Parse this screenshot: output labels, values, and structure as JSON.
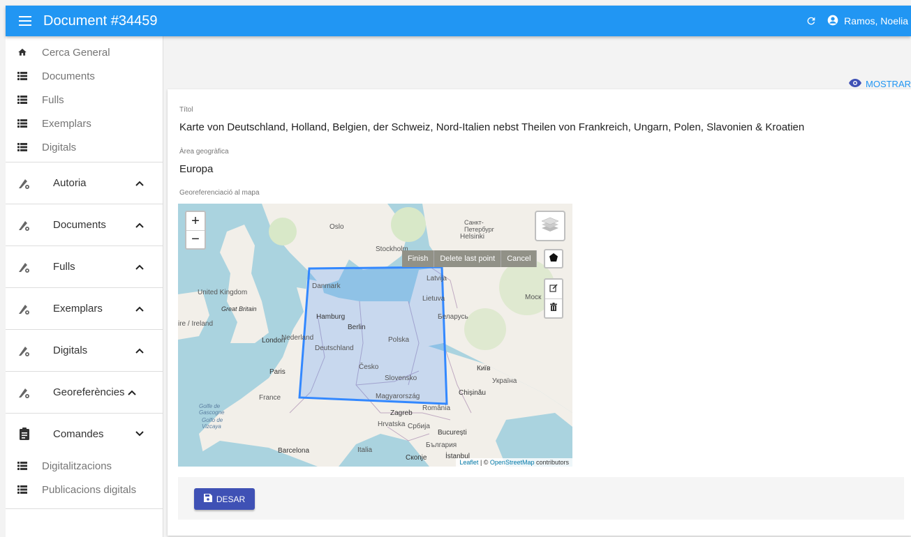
{
  "header": {
    "title": "Document #34459",
    "user_name": "Ramos, Noelia"
  },
  "sidebar": {
    "top_items": [
      {
        "label": "Cerca General",
        "icon": "home-icon"
      },
      {
        "label": "Documents",
        "icon": "list-icon"
      },
      {
        "label": "Fulls",
        "icon": "list-icon"
      },
      {
        "label": "Exemplars",
        "icon": "list-icon"
      },
      {
        "label": "Digitals",
        "icon": "list-icon"
      }
    ],
    "groups": [
      {
        "label": "Autoria",
        "chevron": "up"
      },
      {
        "label": "Documents",
        "chevron": "up"
      },
      {
        "label": "Fulls",
        "chevron": "up"
      },
      {
        "label": "Exemplars",
        "chevron": "up"
      },
      {
        "label": "Digitals",
        "chevron": "up"
      },
      {
        "label": "Georeferències",
        "chevron": "up"
      },
      {
        "label": "Comandes",
        "chevron": "down"
      }
    ],
    "bottom_items": [
      {
        "label": "Digitalitzacions",
        "icon": "list-icon"
      },
      {
        "label": "Publicacions digitals",
        "icon": "list-icon"
      }
    ]
  },
  "main": {
    "show_button": "MOSTRAR",
    "fields": {
      "title_label": "Títol",
      "title_value": "Karte von Deutschland, Holland, Belgien, der Schweiz, Nord-Italien nebst Theilen von Frankreich, Ungarn, Polen, Slavonien & Kroatien",
      "area_label": "Àrea geogràfica",
      "area_value": "Europa",
      "map_label": "Georeferenciació al mapa"
    },
    "map": {
      "zoom_in": "+",
      "zoom_out": "−",
      "draw_actions": [
        "Finish",
        "Delete last point",
        "Cancel"
      ],
      "attribution_leaflet": "Leaflet",
      "attribution_sep": " | © ",
      "attribution_osm": "OpenStreetMap",
      "attribution_tail": " contributors",
      "labels": {
        "oslo": "Oslo",
        "stockholm": "Stockholm",
        "helsinki": "Helsinki",
        "spb": "Санкт-Петербург",
        "latvija": "Latvija",
        "lietuva": "Lietuva",
        "moskva": "Моск",
        "belarus": "Беларусь",
        "danmark": "Danmark",
        "uk": "United Kingdom",
        "gb": "Great Britain",
        "ireland": "ire / Ireland",
        "hamburg": "Hamburg",
        "berlin": "Berlin",
        "nederland": "Nederland",
        "london": "London",
        "deutschland": "Deutschland",
        "polska": "Polska",
        "paris": "Paris",
        "cesko": "Česko",
        "kyiv": "Київ",
        "slovensko": "Slovensko",
        "ukraina": "Україна",
        "france": "France",
        "chisinau": "Chișinău",
        "magyar": "Magyarország",
        "romania": "România",
        "golfe": "Golfe de Gascogne",
        "golfo": "Golfo de Vizcaya",
        "zagreb": "Zagreb",
        "hrvatska": "Hrvatska",
        "srbija": "Србија",
        "bucuresti": "București",
        "barcelona": "Barcelona",
        "italia": "Italia",
        "bulgaria": "България",
        "skopje": "Скопје",
        "istanbul": "İstanbul"
      }
    },
    "save_button": "DESAR"
  },
  "colors": {
    "appbar": "#2196f3",
    "save_button": "#3f51b5",
    "polygon": "#3388ff"
  }
}
